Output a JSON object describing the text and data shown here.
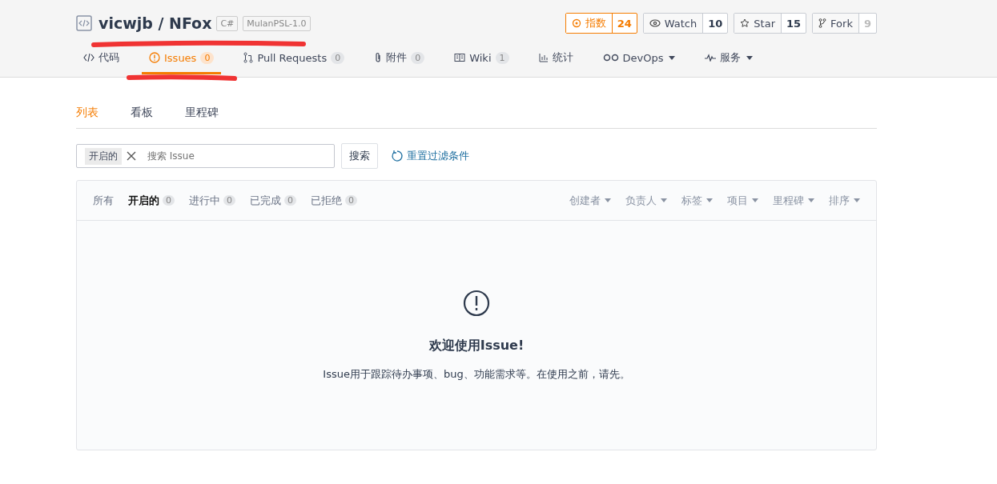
{
  "repo": {
    "title": "vicwjb / NFox",
    "tags": [
      "C#",
      "MulanPSL-1.0"
    ]
  },
  "actions": [
    {
      "kind": "index",
      "label": "指数",
      "count": "24",
      "muted": false
    },
    {
      "kind": "watch",
      "label": "Watch",
      "count": "10",
      "muted": false
    },
    {
      "kind": "star",
      "label": "Star",
      "count": "15",
      "muted": false
    },
    {
      "kind": "fork",
      "label": "Fork",
      "count": "9",
      "muted": true
    }
  ],
  "tabs": [
    {
      "kind": "code",
      "label": "代码",
      "selected": false
    },
    {
      "kind": "issue",
      "label": "Issues",
      "count": "0",
      "selected": true
    },
    {
      "kind": "pr",
      "label": "Pull Requests",
      "count": "0",
      "selected": false
    },
    {
      "kind": "attach",
      "label": "附件",
      "count": "0",
      "selected": false
    },
    {
      "kind": "wiki",
      "label": "Wiki",
      "count": "1",
      "selected": false
    },
    {
      "kind": "stats",
      "label": "统计",
      "selected": false
    },
    {
      "kind": "devops",
      "label": "DevOps",
      "dropdown": true,
      "selected": false
    },
    {
      "kind": "service",
      "label": "服务",
      "dropdown": true,
      "selected": false
    }
  ],
  "views": [
    {
      "label": "列表",
      "selected": true
    },
    {
      "label": "看板",
      "selected": false
    },
    {
      "label": "里程碑",
      "selected": false
    }
  ],
  "search": {
    "chip": "开启的",
    "placeholder": "搜索 Issue",
    "button": "搜索",
    "reset": "重置过滤条件"
  },
  "states": [
    {
      "label": "所有",
      "selected": false
    },
    {
      "label": "开启的",
      "count": "0",
      "selected": true
    },
    {
      "label": "进行中",
      "count": "0",
      "selected": false
    },
    {
      "label": "已完成",
      "count": "0",
      "selected": false
    },
    {
      "label": "已拒绝",
      "count": "0",
      "selected": false
    }
  ],
  "filters": [
    "创建者",
    "负责人",
    "标签",
    "项目",
    "里程碑",
    "排序"
  ],
  "empty": {
    "title": "欢迎使用Issue!",
    "text": "Issue用于跟踪待办事项、bug、功能需求等。在使用之前，请先。"
  }
}
